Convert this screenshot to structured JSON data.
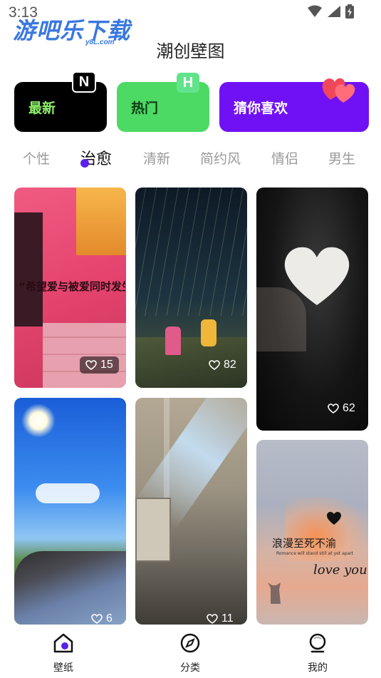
{
  "status_bar": {
    "time": "3:13"
  },
  "watermark": {
    "text": "游吧乐下载",
    "sub": "y8L.com"
  },
  "header": {
    "title": "潮创壁图"
  },
  "categories": [
    {
      "label": "最新",
      "badge": "N"
    },
    {
      "label": "热门",
      "badge": "H"
    },
    {
      "label": "猜你喜欢"
    }
  ],
  "tabs": [
    "个性",
    "治愈",
    "清新",
    "简约风",
    "情侣",
    "男生"
  ],
  "active_tab": "治愈",
  "wallpapers": [
    {
      "likes": "15",
      "caption": "“希望爱与被爱同时发生"
    },
    {
      "likes": "82"
    },
    {
      "likes": "62"
    },
    {
      "likes": "6"
    },
    {
      "likes": "11"
    },
    {
      "likes": "",
      "caption": "浪漫至死不渝",
      "caption_en": "love you",
      "caption_small": "Romance will stand still at yet apart"
    }
  ],
  "bottom_nav": [
    {
      "label": "壁纸",
      "icon": "home-icon"
    },
    {
      "label": "分类",
      "icon": "compass-icon"
    },
    {
      "label": "我的",
      "icon": "profile-icon"
    }
  ],
  "colors": {
    "accent": "#7011f5",
    "hot": "#4cd964",
    "new_text": "#8ef26a"
  }
}
